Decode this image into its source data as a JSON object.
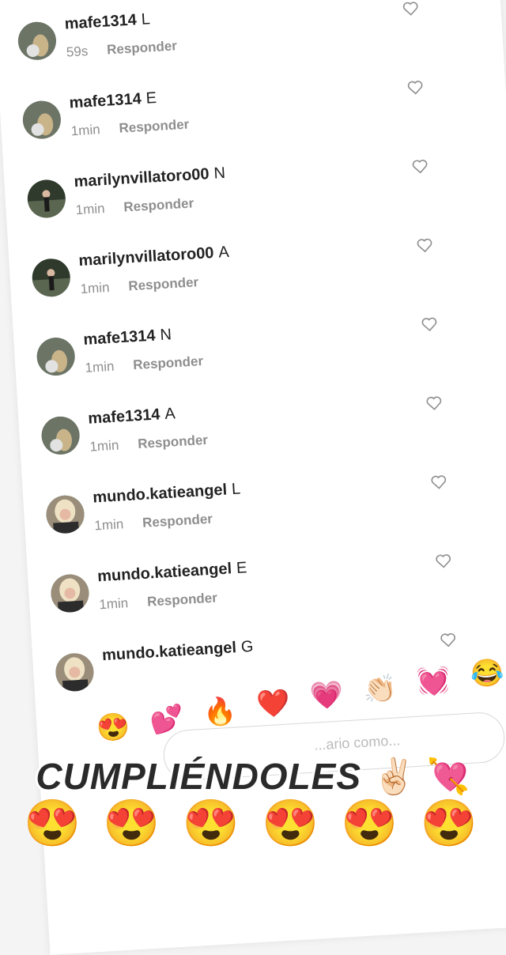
{
  "comments": [
    {
      "user": "mafe1314",
      "text": "L",
      "time": "59s",
      "reply": "Responder",
      "avatar": "mafe"
    },
    {
      "user": "mafe1314",
      "text": "E",
      "time": "1min",
      "reply": "Responder",
      "avatar": "mafe"
    },
    {
      "user": "marilynvillatoro00",
      "text": "N",
      "time": "1min",
      "reply": "Responder",
      "avatar": "marilyn"
    },
    {
      "user": "marilynvillatoro00",
      "text": "A",
      "time": "1min",
      "reply": "Responder",
      "avatar": "marilyn"
    },
    {
      "user": "mafe1314",
      "text": "N",
      "time": "1min",
      "reply": "Responder",
      "avatar": "mafe"
    },
    {
      "user": "mafe1314",
      "text": "A",
      "time": "1min",
      "reply": "Responder",
      "avatar": "mafe"
    },
    {
      "user": "mundo.katieangel",
      "text": "L",
      "time": "1min",
      "reply": "Responder",
      "avatar": "katie"
    },
    {
      "user": "mundo.katieangel",
      "text": "E",
      "time": "1min",
      "reply": "Responder",
      "avatar": "katie"
    },
    {
      "user": "mundo.katieangel",
      "text": "G",
      "time": "",
      "reply": "",
      "avatar": "katie"
    }
  ],
  "emoji_bar": [
    "😍",
    "💕",
    "🔥",
    "❤️",
    "💗",
    "👏🏻",
    "💓",
    "😂"
  ],
  "input_placeholder": "...ario como...",
  "caption": {
    "word": "CUMPLIÉNDOLES",
    "emojis": [
      "✌🏻",
      "💘"
    ]
  },
  "faces": [
    "😍",
    "😍",
    "😍",
    "😍",
    "😍",
    "😍"
  ],
  "icons": {
    "like": "heart-outline-icon"
  }
}
